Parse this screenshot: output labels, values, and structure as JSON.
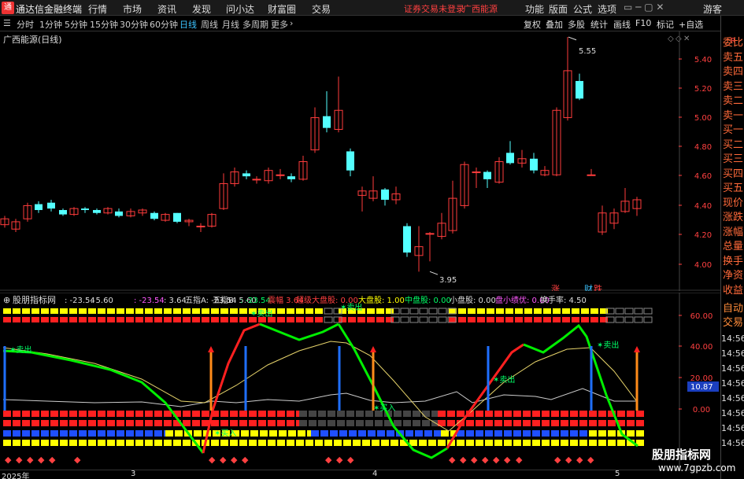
{
  "app": {
    "title": "通达信金融终端",
    "notice": "证券交易未登录",
    "stock_name": "广西能源"
  },
  "menu": [
    "行情",
    "市场",
    "资讯",
    "发现",
    "问小达",
    "财富圈",
    "交易"
  ],
  "top_right": [
    "功能",
    "版面",
    "公式",
    "选项"
  ],
  "guest": "游客",
  "periods": [
    "分时",
    "1分钟",
    "5分钟",
    "15分钟",
    "30分钟",
    "60分钟",
    "日线",
    "周线",
    "月线",
    "多周期",
    "更多"
  ],
  "active_period": "日线",
  "toolbar_right": [
    "复权",
    "叠加",
    "多股",
    "统计",
    "画线",
    "F10",
    "标记",
    "+自选"
  ],
  "chart_title": "广西能源(日线)",
  "right_panel": [
    "委比",
    "卖五",
    "卖四",
    "卖三",
    "卖二",
    "卖一",
    "买一",
    "买二",
    "买三",
    "买四",
    "买五",
    "现价",
    "涨跌",
    "涨幅",
    "总量",
    "换手",
    "净资",
    "收益"
  ],
  "right_panel2": [
    "自动",
    "交易"
  ],
  "right_times": [
    "14:56",
    "14:56",
    "14:56",
    "14:56",
    "14:56",
    "14:56",
    "14:56",
    "14:56"
  ],
  "main_price": {
    "y_ticks": [
      "5.40",
      "5.20",
      "5.00",
      "4.80",
      "4.60",
      "4.40",
      "4.20",
      "4.00"
    ],
    "high_label": "5.55",
    "low_label": "3.95",
    "markers": [
      "涨",
      "财",
      "跌"
    ]
  },
  "indicator": {
    "name": "股朋指标网",
    "values": [
      {
        "label": "",
        "value": "-23.54"
      },
      {
        "label": "",
        "value": "5.60"
      },
      {
        "label": "",
        "value": "-23.54"
      },
      {
        "label": "",
        "value": "3.64"
      },
      {
        "label": "五指A:",
        "value": "-23.54"
      },
      {
        "label": "五指B:",
        "value": "5.60"
      },
      {
        "label": "",
        "value": "-23.54"
      },
      {
        "label": "震幅",
        "value": "3.64"
      },
      {
        "label": "超级大盘股:",
        "value": "0.00"
      },
      {
        "label": "大盘股:",
        "value": "1.00"
      },
      {
        "label": "中盘股:",
        "value": "0.00"
      },
      {
        "label": "小盘股:",
        "value": "0.00"
      },
      {
        "label": "盘小绩优:",
        "value": "0.00"
      },
      {
        "label": "换手率:",
        "value": "4.50"
      }
    ],
    "y_ticks": [
      "60.00",
      "40.00",
      "20.00",
      "0.00"
    ],
    "current_value": "10.87",
    "signals": [
      "卖出",
      "卖出",
      "卖出",
      "卖出",
      "卖出",
      "买入",
      "买入"
    ]
  },
  "time_axis": [
    "2025年",
    "3",
    "4",
    "5"
  ],
  "watermark": {
    "line1": "股朋指标网",
    "line2": "www.7gpzb.com"
  },
  "colors": {
    "up": "#ff3c3c",
    "down": "#54ffff",
    "accent": "#3cc3ff",
    "yellow": "#ffff00",
    "green": "#00ff00"
  }
}
